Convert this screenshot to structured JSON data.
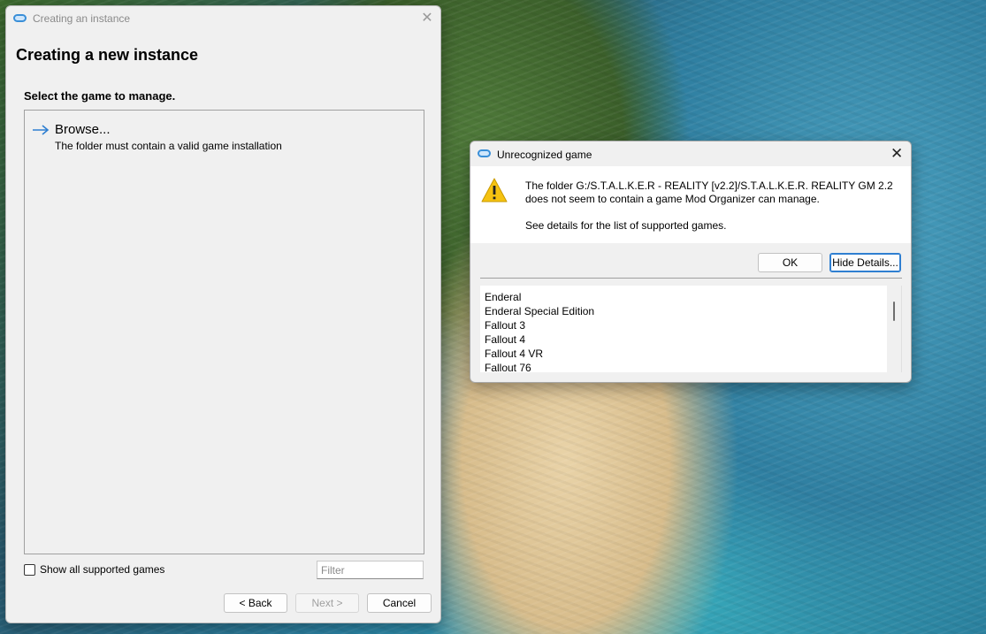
{
  "wizard": {
    "window_title": "Creating an instance",
    "page_title": "Creating a new instance",
    "subtitle": "Select the game to manage.",
    "browse": {
      "label": "Browse...",
      "description": "The folder must contain a valid game installation"
    },
    "show_all_label": "Show all supported games",
    "filter_placeholder": "Filter",
    "buttons": {
      "back": "< Back",
      "next": "Next >",
      "cancel": "Cancel"
    }
  },
  "dialog": {
    "title": "Unrecognized game",
    "message": "The folder G:/S.T.A.L.K.E.R - REALITY [v2.2]/S.T.A.L.K.E.R. REALITY GM 2.2 does not seem to contain a game Mod Organizer can manage.",
    "info": "See details for the list of supported games.",
    "buttons": {
      "ok": "OK",
      "details": "Hide Details..."
    },
    "details_lines": [
      "Enderal",
      "Enderal Special Edition",
      "Fallout 3",
      "Fallout 4",
      "Fallout 4 VR",
      "Fallout 76"
    ]
  },
  "colors": {
    "accent": "#2f7fd1",
    "warning": "#f5c211",
    "window_bg": "#f0f0f0"
  },
  "icons": {
    "app": "mod-organizer-icon",
    "close": "close-icon",
    "browse": "arrow-right-icon",
    "warning": "warning-icon"
  }
}
